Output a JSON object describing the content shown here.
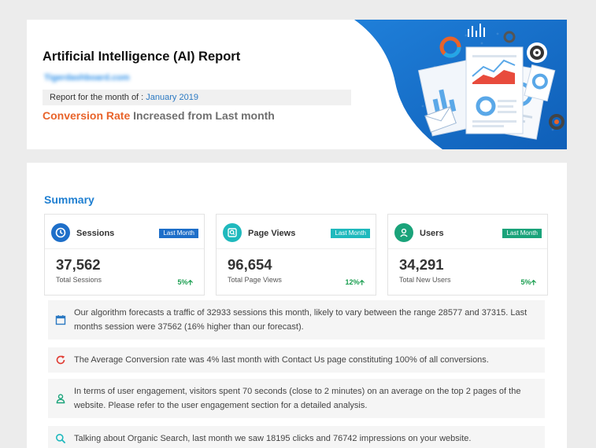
{
  "header": {
    "title": "Artificial Intelligence (AI) Report",
    "site": "Tigerdashboard.com",
    "month_label": "Report for the month of : ",
    "month_value": "January 2019",
    "conversion_highlight": "Conversion Rate",
    "conversion_rest": " Increased from Last month"
  },
  "summary": {
    "title": "Summary",
    "cards": [
      {
        "icon": "clock-icon",
        "label": "Sessions",
        "badge": "Last Month",
        "badge_color": "#1e6fc9",
        "icon_color": "#1e6fc9",
        "value": "37,562",
        "sub": "Total Sessions",
        "pct": "5%"
      },
      {
        "icon": "search-icon",
        "label": "Page Views",
        "badge": "Last Month",
        "badge_color": "#1fb9bd",
        "icon_color": "#1fb9bd",
        "value": "96,654",
        "sub": "Total Page Views",
        "pct": "12%"
      },
      {
        "icon": "user-icon",
        "label": "Users",
        "badge": "Last Month",
        "badge_color": "#1aa37a",
        "icon_color": "#1aa37a",
        "value": "34,291",
        "sub": "Total New Users",
        "pct": "5%"
      }
    ],
    "insights": [
      {
        "icon": "calendar-icon",
        "color": "#2b79c2",
        "text": "Our algorithm forecasts a traffic of 32933 sessions this month, likely to vary between the range 28577 and 37315. Last months session were 37562 (16% higher than our forecast)."
      },
      {
        "icon": "refresh-icon",
        "color": "#e03b32",
        "text": "The Average Conversion rate was 4% last month with Contact Us page constituting 100% of all conversions."
      },
      {
        "icon": "user-outline-icon",
        "color": "#1aa37a",
        "text": "In terms of user engagement, visitors spent 70 seconds (close to 2 minutes) on an average on the top 2 pages of the website. Please refer to the user engagement section for a detailed analysis."
      },
      {
        "icon": "search-icon",
        "color": "#1fb9bd",
        "text": "Talking about Organic Search, last month we saw 18195 clicks and 76742 impressions on your website."
      }
    ]
  }
}
